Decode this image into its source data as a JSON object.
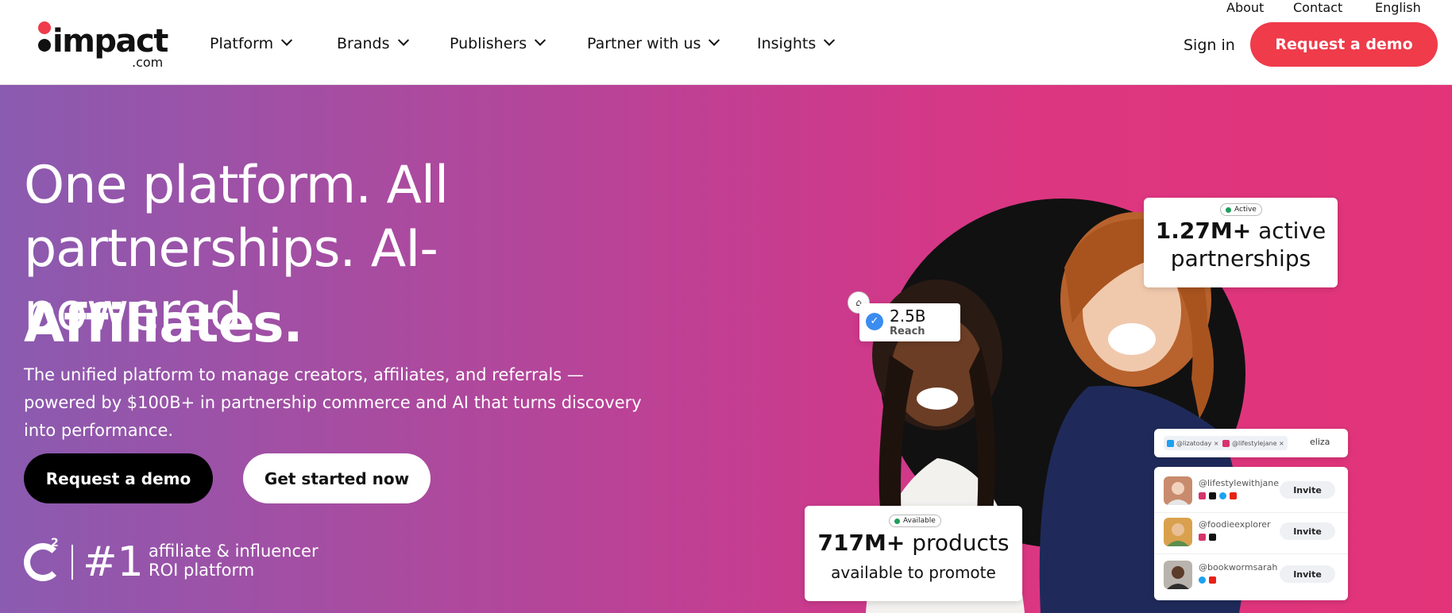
{
  "brand": {
    "name": "impact",
    "suffix": ".com"
  },
  "utility_nav": {
    "about": "About",
    "contact": "Contact",
    "language": "English"
  },
  "nav": {
    "items": [
      {
        "label": "Platform"
      },
      {
        "label": "Brands"
      },
      {
        "label": "Publishers"
      },
      {
        "label": "Partner with us"
      },
      {
        "label": "Insights"
      }
    ],
    "sign_in": "Sign in",
    "cta": "Request a demo"
  },
  "hero": {
    "headline": "One platform. All partnerships. AI-powered.",
    "headline_strong": "Affiliates.",
    "lead": "The unified platform to manage creators, affiliates, and referrals — powered by $100B+ in partnership commerce and AI that turns discovery into performance.",
    "primary_cta": "Request a demo",
    "secondary_cta": "Get started now",
    "award": {
      "badge_letter": "2",
      "rank": "#1",
      "line1": "affiliate & influencer",
      "line2": "ROI platform"
    }
  },
  "illustration": {
    "partnerships_card": {
      "badge": "Active",
      "value": "1.27M+",
      "value_suffix": "active",
      "label": "partnerships"
    },
    "reach_card": {
      "value": "2.5B",
      "label": "Reach"
    },
    "search_tags": {
      "tag1": "@lizatoday",
      "tag2": "@lifestylejane",
      "query": "eliza"
    },
    "creators": [
      {
        "handle": "@lifestylewithjane",
        "action": "Invite"
      },
      {
        "handle": "@foodieexplorer",
        "action": "Invite"
      },
      {
        "handle": "@bookwormsarah",
        "action": "Invite"
      }
    ],
    "products_card": {
      "badge": "Available",
      "value": "717M+",
      "value_suffix": "products",
      "label": "available to promote"
    }
  },
  "colors": {
    "accent": "#ef3b4a",
    "gradient_start": "#8a5bb0",
    "gradient_end": "#e33479"
  }
}
